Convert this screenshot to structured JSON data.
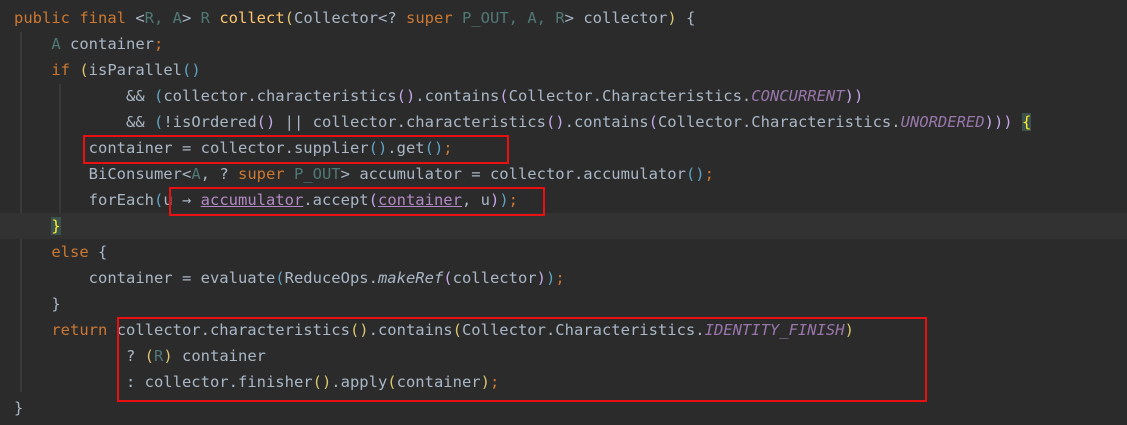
{
  "colors": {
    "background": "#2b2b2b",
    "current_line": "#323232",
    "keyword": "#cc7832",
    "method_decl": "#ffc66d",
    "text": "#a9b7c6",
    "type_param": "#507874",
    "constant": "#9876aa",
    "parameter_ref": "#b389c5",
    "brace_match": "#ffef28",
    "highlight_box": "#e81010",
    "paren_level_1": "#d8c66f",
    "paren_level_2": "#5fa3c1",
    "paren_level_3": "#c3a6e8"
  },
  "code_lines": [
    [
      {
        "t": "public final ",
        "c": "#cc7832"
      },
      {
        "t": "<",
        "c": "#a9b7c6"
      },
      {
        "t": "R, A",
        "c": "#507874"
      },
      {
        "t": "> ",
        "c": "#a9b7c6"
      },
      {
        "t": "R ",
        "c": "#507874"
      },
      {
        "t": "collect",
        "c": "#ffc66d"
      },
      {
        "t": "(",
        "c": "#d8c66f"
      },
      {
        "t": "Collector<? ",
        "c": "#a9b7c6"
      },
      {
        "t": "super ",
        "c": "#cc7832"
      },
      {
        "t": "P_OUT, A, R",
        "c": "#507874"
      },
      {
        "t": "> collector",
        "c": "#a9b7c6"
      },
      {
        "t": ")",
        "c": "#d8c66f"
      },
      {
        "t": " {",
        "c": "#a9b7c6"
      }
    ],
    [
      {
        "t": "    ",
        "c": "#a9b7c6"
      },
      {
        "t": "A ",
        "c": "#507874"
      },
      {
        "t": "container",
        "c": "#a9b7c6"
      },
      {
        "t": ";",
        "c": "#cc7832"
      }
    ],
    [
      {
        "t": "    ",
        "c": "#a9b7c6"
      },
      {
        "t": "if ",
        "c": "#cc7832"
      },
      {
        "t": "(",
        "c": "#d8c66f"
      },
      {
        "t": "isParallel",
        "c": "#a9b7c6"
      },
      {
        "t": "()",
        "c": "#5fa3c1"
      }
    ],
    [
      {
        "t": "            && ",
        "c": "#a9b7c6"
      },
      {
        "t": "(",
        "c": "#5fa3c1"
      },
      {
        "t": "collector.characteristics",
        "c": "#a9b7c6"
      },
      {
        "t": "()",
        "c": "#c3a6e8"
      },
      {
        "t": ".contains",
        "c": "#a9b7c6"
      },
      {
        "t": "(",
        "c": "#c3a6e8"
      },
      {
        "t": "Collector.Characteristics.",
        "c": "#a9b7c6"
      },
      {
        "t": "CONCURRENT",
        "c": "#9876aa",
        "i": true
      },
      {
        "t": "))",
        "c": "#c3a6e8"
      }
    ],
    [
      {
        "t": "            && ",
        "c": "#a9b7c6"
      },
      {
        "t": "(",
        "c": "#5fa3c1"
      },
      {
        "t": "!isOrdered",
        "c": "#a9b7c6"
      },
      {
        "t": "()",
        "c": "#c3a6e8"
      },
      {
        "t": " || collector.characteristics",
        "c": "#a9b7c6"
      },
      {
        "t": "()",
        "c": "#c3a6e8"
      },
      {
        "t": ".contains",
        "c": "#a9b7c6"
      },
      {
        "t": "(",
        "c": "#c3a6e8"
      },
      {
        "t": "Collector.Characteristics.",
        "c": "#a9b7c6"
      },
      {
        "t": "UNORDERED",
        "c": "#9876aa",
        "i": true
      },
      {
        "t": ")))",
        "c": "#c3a6e8"
      },
      {
        "t": " ",
        "c": "#a9b7c6"
      },
      {
        "t": "{",
        "c": "#ffef28",
        "m": true
      }
    ],
    [
      {
        "t": "        container = collector.supplier",
        "c": "#a9b7c6"
      },
      {
        "t": "()",
        "c": "#5fa3c1"
      },
      {
        "t": ".get",
        "c": "#a9b7c6"
      },
      {
        "t": "()",
        "c": "#5fa3c1"
      },
      {
        "t": ";",
        "c": "#cc7832"
      }
    ],
    [
      {
        "t": "        BiConsumer<",
        "c": "#a9b7c6"
      },
      {
        "t": "A",
        "c": "#507874"
      },
      {
        "t": ", ? ",
        "c": "#a9b7c6"
      },
      {
        "t": "super ",
        "c": "#cc7832"
      },
      {
        "t": "P_OUT",
        "c": "#507874"
      },
      {
        "t": "> accumulator = collector.accumulator",
        "c": "#a9b7c6"
      },
      {
        "t": "()",
        "c": "#5fa3c1"
      },
      {
        "t": ";",
        "c": "#cc7832"
      }
    ],
    [
      {
        "t": "        forEach",
        "c": "#a9b7c6"
      },
      {
        "t": "(",
        "c": "#5fa3c1"
      },
      {
        "t": "u → ",
        "c": "#a9b7c6"
      },
      {
        "t": "accumulator",
        "c": "#b389c5",
        "u": true
      },
      {
        "t": ".accept",
        "c": "#a9b7c6"
      },
      {
        "t": "(",
        "c": "#c3a6e8"
      },
      {
        "t": "container",
        "c": "#b389c5",
        "u": true
      },
      {
        "t": ", u",
        "c": "#a9b7c6"
      },
      {
        "t": ")",
        "c": "#c3a6e8"
      },
      {
        "t": ")",
        "c": "#5fa3c1"
      },
      {
        "t": ";",
        "c": "#cc7832"
      }
    ],
    [
      {
        "t": "    ",
        "c": "#a9b7c6"
      },
      {
        "t": "}",
        "c": "#ffef28",
        "m": true
      }
    ],
    [
      {
        "t": "    ",
        "c": "#a9b7c6"
      },
      {
        "t": "else ",
        "c": "#cc7832"
      },
      {
        "t": "{",
        "c": "#a9b7c6"
      }
    ],
    [
      {
        "t": "        container = evaluate",
        "c": "#a9b7c6"
      },
      {
        "t": "(",
        "c": "#5fa3c1"
      },
      {
        "t": "ReduceOps.",
        "c": "#a9b7c6"
      },
      {
        "t": "makeRef",
        "c": "#a9b7c6",
        "i": true
      },
      {
        "t": "(",
        "c": "#c3a6e8"
      },
      {
        "t": "collector",
        "c": "#a9b7c6"
      },
      {
        "t": ")",
        "c": "#c3a6e8"
      },
      {
        "t": ")",
        "c": "#5fa3c1"
      },
      {
        "t": ";",
        "c": "#cc7832"
      }
    ],
    [
      {
        "t": "    }",
        "c": "#a9b7c6"
      }
    ],
    [
      {
        "t": "    ",
        "c": "#a9b7c6"
      },
      {
        "t": "return ",
        "c": "#cc7832"
      },
      {
        "t": "collector.characteristics",
        "c": "#a9b7c6"
      },
      {
        "t": "()",
        "c": "#d8c66f"
      },
      {
        "t": ".contains",
        "c": "#a9b7c6"
      },
      {
        "t": "(",
        "c": "#d8c66f"
      },
      {
        "t": "Collector.Characteristics.",
        "c": "#a9b7c6"
      },
      {
        "t": "IDENTITY_FINISH",
        "c": "#9876aa",
        "i": true
      },
      {
        "t": ")",
        "c": "#d8c66f"
      }
    ],
    [
      {
        "t": "            ? ",
        "c": "#a9b7c6"
      },
      {
        "t": "(",
        "c": "#d8c66f"
      },
      {
        "t": "R",
        "c": "#507874"
      },
      {
        "t": ")",
        "c": "#d8c66f"
      },
      {
        "t": " container",
        "c": "#a9b7c6"
      }
    ],
    [
      {
        "t": "            : collector.finisher",
        "c": "#a9b7c6"
      },
      {
        "t": "()",
        "c": "#d8c66f"
      },
      {
        "t": ".apply",
        "c": "#a9b7c6"
      },
      {
        "t": "(",
        "c": "#d8c66f"
      },
      {
        "t": "container",
        "c": "#a9b7c6"
      },
      {
        "t": ")",
        "c": "#d8c66f"
      },
      {
        "t": ";",
        "c": "#cc7832"
      }
    ],
    [
      {
        "t": "}",
        "c": "#a9b7c6"
      }
    ]
  ],
  "current_line_index": 8,
  "highlight_boxes": [
    {
      "name": "highlight-supplier-line"
    },
    {
      "name": "highlight-lambda"
    },
    {
      "name": "highlight-return-expression"
    }
  ]
}
